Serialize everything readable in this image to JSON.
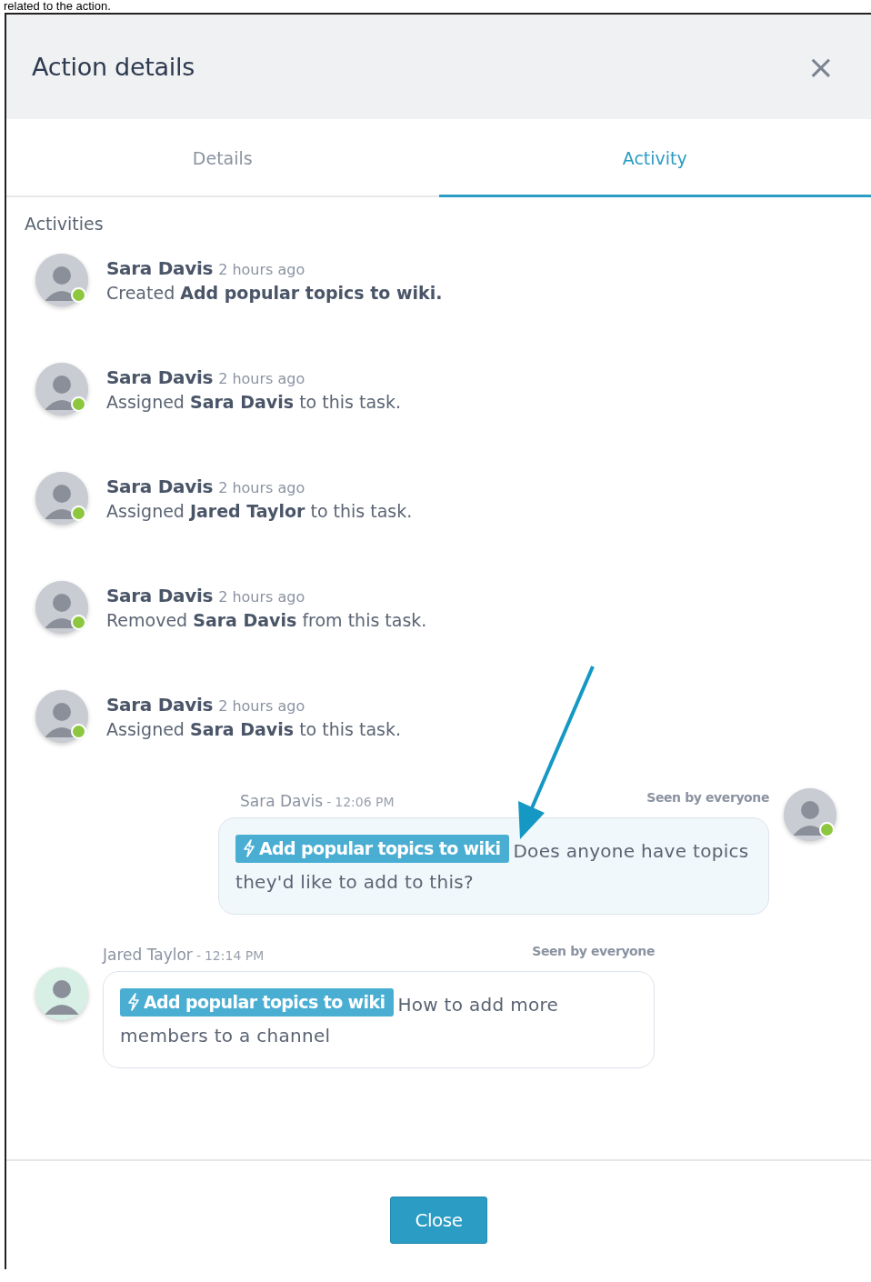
{
  "caption": "related to the action.",
  "dialog": {
    "title": "Action details",
    "close_icon": "×"
  },
  "tabs": [
    {
      "label": "Details",
      "selected": false
    },
    {
      "label": "Activity",
      "selected": true
    }
  ],
  "activities_heading": "Activities",
  "activities": [
    {
      "author": "Sara Davis",
      "time": "2 hours ago",
      "text": "Created **Add popular topics to wiki.**",
      "online": true
    },
    {
      "author": "Sara Davis",
      "time": "2 hours ago",
      "text": "Assigned **Sara Davis** to this task.",
      "online": true
    },
    {
      "author": "Sara Davis",
      "time": "2 hours ago",
      "text": "Assigned **Jared Taylor** to this task.",
      "online": true
    },
    {
      "author": "Sara Davis",
      "time": "2 hours ago",
      "text": "Removed **Sara Davis** from this task.",
      "online": true
    },
    {
      "author": "Sara Davis",
      "time": "2 hours ago",
      "text": "Assigned **Sara Davis** to this task.",
      "online": true
    }
  ],
  "messages": [
    {
      "kind": "sent",
      "author": "Sara Davis",
      "separator": "-",
      "time": "12:06 PM",
      "seen": "Seen by everyone",
      "tag": "Add popular topics to wiki",
      "text": "Does anyone have topics they'd like to add to this?",
      "online": true
    },
    {
      "kind": "received",
      "author": "Jared Taylor",
      "separator": "-",
      "time": "12:14 PM",
      "seen": "Seen by everyone",
      "tag": "Add popular topics to wiki",
      "text": "How to add more members to a channel"
    }
  ],
  "footer": {
    "button": "Close"
  }
}
